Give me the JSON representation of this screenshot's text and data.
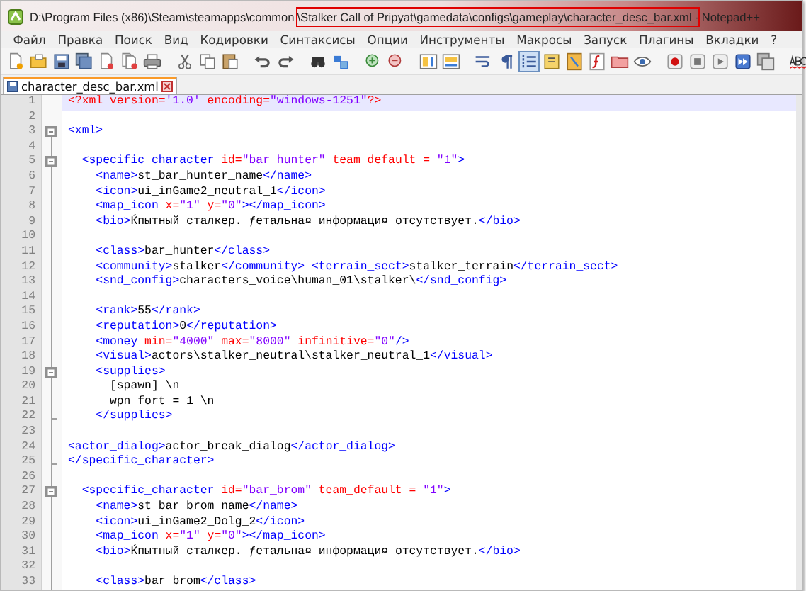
{
  "window": {
    "title": [
      {
        "text": "D:\\Program Files (x86)\\Steam\\steamapps\\common",
        "boxed": false
      },
      {
        "text": "\\Stalker Call of Pripyat\\gamedata\\configs\\gameplay\\character_desc_bar.xml -",
        "boxed": true
      },
      {
        "text": "Notepad++",
        "boxed": false
      }
    ]
  },
  "menu": [
    "Файл",
    "Правка",
    "Поиск",
    "Вид",
    "Кодировки",
    "Синтаксисы",
    "Опции",
    "Инструменты",
    "Макросы",
    "Запуск",
    "Плагины",
    "Вкладки",
    "?"
  ],
  "toolbar": [
    {
      "kind": "new",
      "pressed": false
    },
    {
      "kind": "open",
      "pressed": false
    },
    {
      "kind": "save",
      "pressed": false
    },
    {
      "kind": "saveall",
      "pressed": false
    },
    {
      "kind": "close",
      "pressed": false
    },
    {
      "kind": "closeall",
      "pressed": false
    },
    {
      "kind": "print",
      "pressed": false
    },
    {
      "kind": "separator"
    },
    {
      "kind": "cut",
      "pressed": false
    },
    {
      "kind": "copy",
      "pressed": false
    },
    {
      "kind": "paste",
      "pressed": false
    },
    {
      "kind": "separator"
    },
    {
      "kind": "undo",
      "pressed": false
    },
    {
      "kind": "redo",
      "pressed": false
    },
    {
      "kind": "separator"
    },
    {
      "kind": "find",
      "pressed": false
    },
    {
      "kind": "replace",
      "pressed": false
    },
    {
      "kind": "separator"
    },
    {
      "kind": "zoomin",
      "pressed": false
    },
    {
      "kind": "zoomout",
      "pressed": false
    },
    {
      "kind": "separator"
    },
    {
      "kind": "syncv",
      "pressed": false
    },
    {
      "kind": "synch",
      "pressed": false
    },
    {
      "kind": "separator"
    },
    {
      "kind": "wrap",
      "pressed": false
    },
    {
      "kind": "allchars",
      "pressed": false
    },
    {
      "kind": "indentguide",
      "pressed": true
    },
    {
      "kind": "udl",
      "pressed": false
    },
    {
      "kind": "map",
      "pressed": false
    },
    {
      "kind": "function",
      "pressed": false
    },
    {
      "kind": "folder",
      "pressed": false
    },
    {
      "kind": "eye",
      "pressed": false
    },
    {
      "kind": "separator"
    },
    {
      "kind": "record",
      "pressed": false
    },
    {
      "kind": "stop",
      "pressed": false
    },
    {
      "kind": "play",
      "pressed": false
    },
    {
      "kind": "playmulti",
      "pressed": false
    },
    {
      "kind": "savemacro",
      "pressed": false
    },
    {
      "kind": "separator"
    },
    {
      "kind": "spellcheck",
      "pressed": false
    }
  ],
  "tabs": [
    {
      "label": "character_desc_bar.xml",
      "selected": true
    }
  ],
  "editor": {
    "lines": [
      {
        "number": "1",
        "collapsible": false,
        "block_end": false,
        "current": true,
        "tokens": [
          {
            "kind": "decl",
            "text": "<?xml "
          },
          {
            "kind": "attr",
            "text": "version="
          },
          {
            "kind": "value",
            "text": "'1.0' "
          },
          {
            "kind": "attr",
            "text": "encoding="
          },
          {
            "kind": "value",
            "text": "\"windows-1251\""
          },
          {
            "kind": "decl",
            "text": "?>"
          }
        ]
      },
      {
        "number": "2",
        "collapsible": false,
        "block_end": false,
        "current": false
      },
      {
        "number": "3",
        "collapsible": true,
        "block_end": false,
        "current": false,
        "tokens": [
          {
            "kind": "tag",
            "text": "<xml>"
          }
        ]
      },
      {
        "number": "4",
        "collapsible": false,
        "block_end": false,
        "current": false
      },
      {
        "number": "5",
        "collapsible": true,
        "block_end": false,
        "current": false,
        "tokens": [
          {
            "kind": "tag",
            "text": "  <specific_character "
          },
          {
            "kind": "attr",
            "text": "id="
          },
          {
            "kind": "value",
            "text": "\"bar_hunter\" "
          },
          {
            "kind": "attr",
            "text": "team_default = "
          },
          {
            "kind": "value",
            "text": "\"1\""
          },
          {
            "kind": "tag",
            "text": ">"
          }
        ]
      },
      {
        "number": "6",
        "collapsible": false,
        "block_end": false,
        "current": false,
        "tokens": [
          {
            "kind": "tag",
            "text": "    <name>"
          },
          {
            "kind": "text",
            "text": "st_bar_hunter_name"
          },
          {
            "kind": "tag",
            "text": "</name>"
          }
        ]
      },
      {
        "number": "7",
        "collapsible": false,
        "block_end": false,
        "current": false,
        "tokens": [
          {
            "kind": "tag",
            "text": "    <icon>"
          },
          {
            "kind": "text",
            "text": "ui_inGame2_neutral_1"
          },
          {
            "kind": "tag",
            "text": "</icon>"
          }
        ]
      },
      {
        "number": "8",
        "collapsible": false,
        "block_end": false,
        "current": false,
        "tokens": [
          {
            "kind": "tag",
            "text": "    <map_icon "
          },
          {
            "kind": "attr",
            "text": "x="
          },
          {
            "kind": "value",
            "text": "\"1\" "
          },
          {
            "kind": "attr",
            "text": "y="
          },
          {
            "kind": "value",
            "text": "\"0\""
          },
          {
            "kind": "tag",
            "text": "></map_icon>"
          }
        ]
      },
      {
        "number": "9",
        "collapsible": false,
        "block_end": false,
        "current": false,
        "tokens": [
          {
            "kind": "tag",
            "text": "    <bio>"
          },
          {
            "kind": "text",
            "text": "Ќпытный сталкер. ƒетальна¤ информаци¤ отсутствует."
          },
          {
            "kind": "tag",
            "text": "</bio>"
          }
        ]
      },
      {
        "number": "10",
        "collapsible": false,
        "block_end": false,
        "current": false
      },
      {
        "number": "11",
        "collapsible": false,
        "block_end": false,
        "current": false,
        "tokens": [
          {
            "kind": "tag",
            "text": "    <class>"
          },
          {
            "kind": "text",
            "text": "bar_hunter"
          },
          {
            "kind": "tag",
            "text": "</class>"
          }
        ]
      },
      {
        "number": "12",
        "collapsible": false,
        "block_end": false,
        "current": false,
        "tokens": [
          {
            "kind": "tag",
            "text": "    <community>"
          },
          {
            "kind": "text",
            "text": "stalker"
          },
          {
            "kind": "tag",
            "text": "</community> <terrain_sect>"
          },
          {
            "kind": "text",
            "text": "stalker_terrain"
          },
          {
            "kind": "tag",
            "text": "</terrain_sect>"
          }
        ]
      },
      {
        "number": "13",
        "collapsible": false,
        "block_end": false,
        "current": false,
        "tokens": [
          {
            "kind": "tag",
            "text": "    <snd_config>"
          },
          {
            "kind": "text",
            "text": "characters_voice\\human_01\\stalker\\"
          },
          {
            "kind": "tag",
            "text": "</snd_config>"
          }
        ]
      },
      {
        "number": "14",
        "collapsible": false,
        "block_end": false,
        "current": false
      },
      {
        "number": "15",
        "collapsible": false,
        "block_end": false,
        "current": false,
        "tokens": [
          {
            "kind": "tag",
            "text": "    <rank>"
          },
          {
            "kind": "text",
            "text": "55"
          },
          {
            "kind": "tag",
            "text": "</rank>"
          }
        ]
      },
      {
        "number": "16",
        "collapsible": false,
        "block_end": false,
        "current": false,
        "tokens": [
          {
            "kind": "tag",
            "text": "    <reputation>"
          },
          {
            "kind": "text",
            "text": "0"
          },
          {
            "kind": "tag",
            "text": "</reputation>"
          }
        ]
      },
      {
        "number": "17",
        "collapsible": false,
        "block_end": false,
        "current": false,
        "tokens": [
          {
            "kind": "tag",
            "text": "    <money "
          },
          {
            "kind": "attr",
            "text": "min="
          },
          {
            "kind": "value",
            "text": "\"4000\" "
          },
          {
            "kind": "attr",
            "text": "max="
          },
          {
            "kind": "value",
            "text": "\"8000\" "
          },
          {
            "kind": "attr",
            "text": "infinitive="
          },
          {
            "kind": "value",
            "text": "\"0\""
          },
          {
            "kind": "tag",
            "text": "/>"
          }
        ]
      },
      {
        "number": "18",
        "collapsible": false,
        "block_end": false,
        "current": false,
        "tokens": [
          {
            "kind": "tag",
            "text": "    <visual>"
          },
          {
            "kind": "text",
            "text": "actors\\stalker_neutral\\stalker_neutral_1"
          },
          {
            "kind": "tag",
            "text": "</visual>"
          }
        ]
      },
      {
        "number": "19",
        "collapsible": true,
        "block_end": false,
        "current": false,
        "tokens": [
          {
            "kind": "tag",
            "text": "    <supplies>"
          }
        ]
      },
      {
        "number": "20",
        "collapsible": false,
        "block_end": false,
        "current": false,
        "tokens": [
          {
            "kind": "text",
            "text": "      [spawn] \\n"
          }
        ]
      },
      {
        "number": "21",
        "collapsible": false,
        "block_end": false,
        "current": false,
        "tokens": [
          {
            "kind": "text",
            "text": "      wpn_fort = 1 \\n"
          }
        ]
      },
      {
        "number": "22",
        "collapsible": false,
        "block_end": true,
        "current": false,
        "tokens": [
          {
            "kind": "tag",
            "text": "    </supplies>"
          }
        ]
      },
      {
        "number": "23",
        "collapsible": false,
        "block_end": false,
        "current": false
      },
      {
        "number": "24",
        "collapsible": false,
        "block_end": false,
        "current": false,
        "tokens": [
          {
            "kind": "tag",
            "text": "<actor_dialog>"
          },
          {
            "kind": "text",
            "text": "actor_break_dialog"
          },
          {
            "kind": "tag",
            "text": "</actor_dialog>"
          }
        ]
      },
      {
        "number": "25",
        "collapsible": false,
        "block_end": true,
        "current": false,
        "tokens": [
          {
            "kind": "tag",
            "text": "</specific_character>"
          }
        ]
      },
      {
        "number": "26",
        "collapsible": false,
        "block_end": false,
        "current": false
      },
      {
        "number": "27",
        "collapsible": true,
        "block_end": false,
        "current": false,
        "tokens": [
          {
            "kind": "tag",
            "text": "  <specific_character "
          },
          {
            "kind": "attr",
            "text": "id="
          },
          {
            "kind": "value",
            "text": "\"bar_brom\" "
          },
          {
            "kind": "attr",
            "text": "team_default = "
          },
          {
            "kind": "value",
            "text": "\"1\""
          },
          {
            "kind": "tag",
            "text": ">"
          }
        ]
      },
      {
        "number": "28",
        "collapsible": false,
        "block_end": false,
        "current": false,
        "tokens": [
          {
            "kind": "tag",
            "text": "    <name>"
          },
          {
            "kind": "text",
            "text": "st_bar_brom_name"
          },
          {
            "kind": "tag",
            "text": "</name>"
          }
        ]
      },
      {
        "number": "29",
        "collapsible": false,
        "block_end": false,
        "current": false,
        "tokens": [
          {
            "kind": "tag",
            "text": "    <icon>"
          },
          {
            "kind": "text",
            "text": "ui_inGame2_Dolg_2"
          },
          {
            "kind": "tag",
            "text": "</icon>"
          }
        ]
      },
      {
        "number": "30",
        "collapsible": false,
        "block_end": false,
        "current": false,
        "tokens": [
          {
            "kind": "tag",
            "text": "    <map_icon "
          },
          {
            "kind": "attr",
            "text": "x="
          },
          {
            "kind": "value",
            "text": "\"1\" "
          },
          {
            "kind": "attr",
            "text": "y="
          },
          {
            "kind": "value",
            "text": "\"0\""
          },
          {
            "kind": "tag",
            "text": "></map_icon>"
          }
        ]
      },
      {
        "number": "31",
        "collapsible": false,
        "block_end": false,
        "current": false,
        "tokens": [
          {
            "kind": "tag",
            "text": "    <bio>"
          },
          {
            "kind": "text",
            "text": "Ќпытный сталкер. ƒетальна¤ информаци¤ отсутствует."
          },
          {
            "kind": "tag",
            "text": "</bio>"
          }
        ]
      },
      {
        "number": "32",
        "collapsible": false,
        "block_end": false,
        "current": false
      },
      {
        "number": "33",
        "collapsible": false,
        "block_end": false,
        "current": false,
        "tokens": [
          {
            "kind": "tag",
            "text": "    <class>"
          },
          {
            "kind": "text",
            "text": "bar_brom"
          },
          {
            "kind": "tag",
            "text": "</class>"
          }
        ]
      }
    ]
  }
}
